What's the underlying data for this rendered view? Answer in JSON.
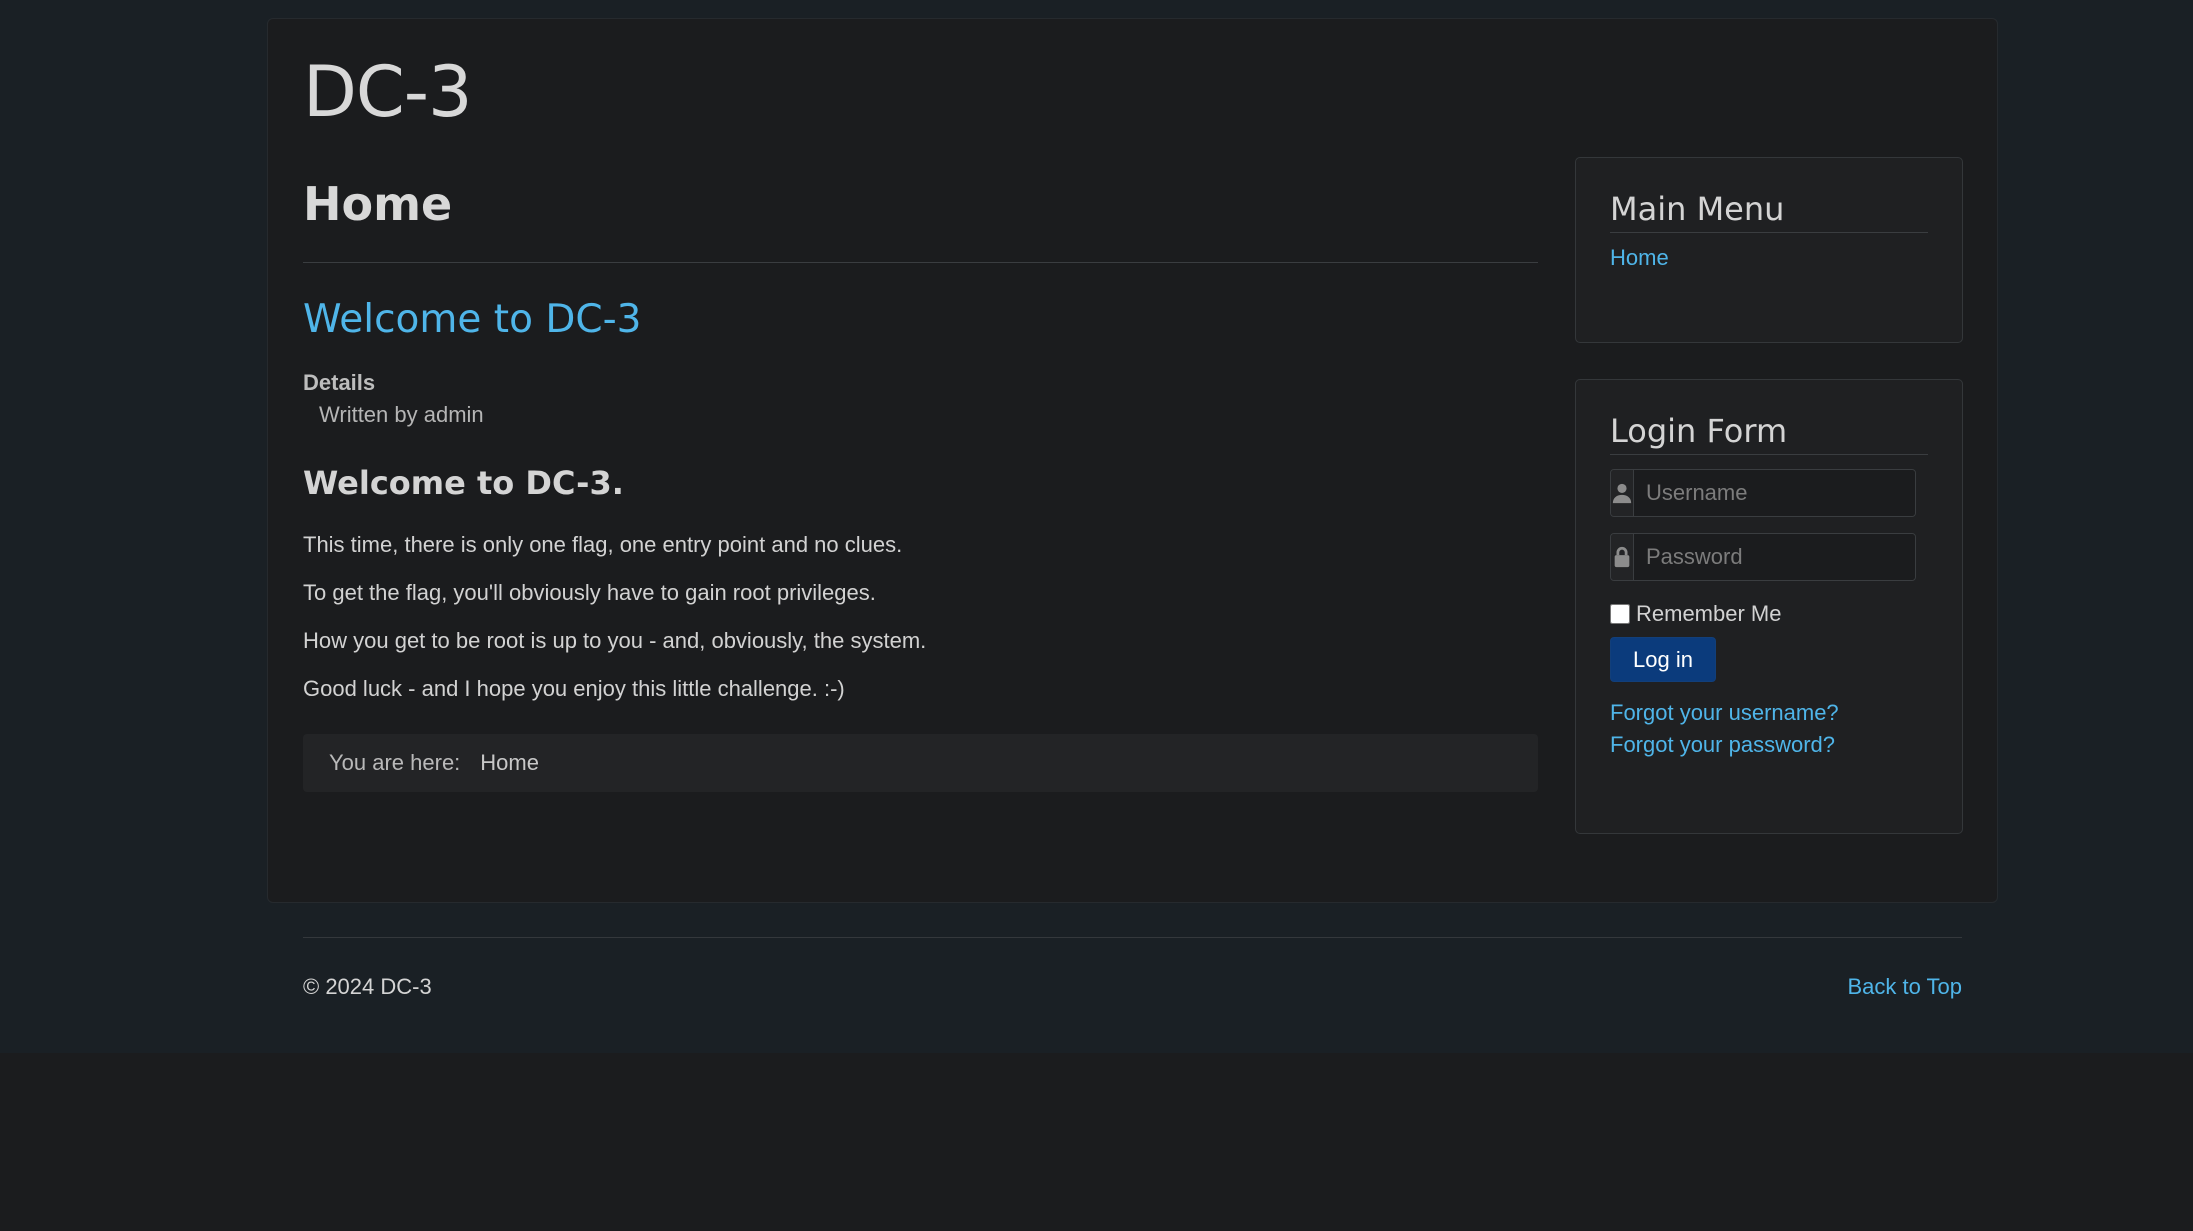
{
  "site": {
    "brand": "DC-3"
  },
  "main": {
    "page_title": "Home",
    "article": {
      "title": "Welcome to DC-3",
      "details_label": "Details",
      "written_by": "Written by admin",
      "heading": "Welcome to DC-3.",
      "paragraphs": [
        "This time, there is only one flag, one entry point and no clues.",
        "To get the flag, you'll obviously have to gain root privileges.",
        "How you get to be root is up to you - and, obviously, the system.",
        "Good luck - and I hope you enjoy this little challenge.  :-)"
      ]
    },
    "breadcrumb": {
      "label": "You are here:",
      "current": "Home"
    }
  },
  "sidebar": {
    "main_menu": {
      "title": "Main Menu",
      "items": [
        {
          "label": "Home"
        }
      ]
    },
    "login_form": {
      "title": "Login Form",
      "username_placeholder": "Username",
      "password_placeholder": "Password",
      "remember_label": "Remember Me",
      "login_button": "Log in",
      "forgot_username": "Forgot your username?",
      "forgot_password": "Forgot your password?",
      "username_icon": "user-icon",
      "password_icon": "lock-icon"
    }
  },
  "footer": {
    "copyright": "© 2024 DC-3",
    "back_to_top": "Back to Top"
  },
  "colors": {
    "link": "#4fb5e9",
    "button": "#0b3b7c",
    "background": "#1b1c1e"
  }
}
